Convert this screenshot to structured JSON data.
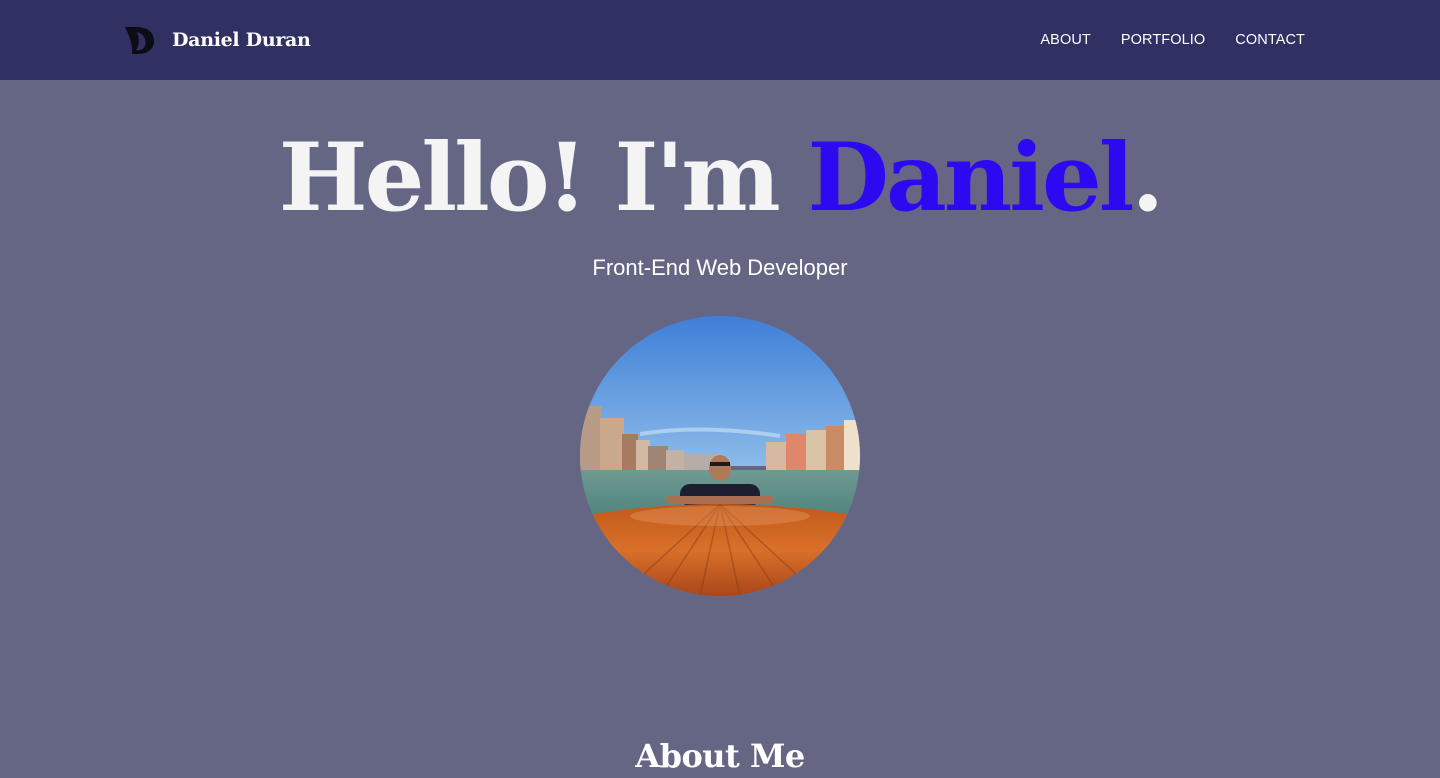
{
  "nav": {
    "brand_name": "Daniel Duran",
    "brand_logo_icon": "d-letter-logo-icon",
    "links": [
      "ABOUT",
      "PORTFOLIO",
      "CONTACT"
    ]
  },
  "hero": {
    "greeting": "Hello! I'm ",
    "name": "Daniel",
    "period": ".",
    "subtitle": "Front-End Web Developer",
    "photo_icon": "profile-photo"
  },
  "about": {
    "title": "About Me"
  },
  "colors": {
    "navbar_bg": "#313062",
    "page_bg": "#656684",
    "accent": "#2b0af2",
    "text": "#ffffff"
  }
}
